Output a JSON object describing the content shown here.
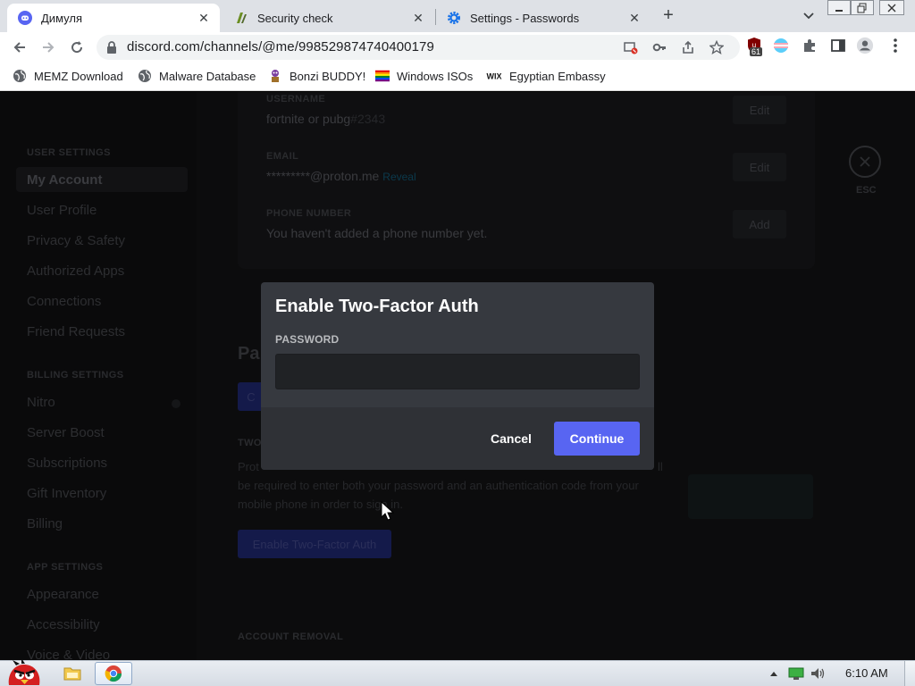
{
  "tabs": [
    {
      "label": "Димуля",
      "close": "✕",
      "favicon": "discord-icon"
    },
    {
      "label": "Security check",
      "close": "✕",
      "favicon": "security-check-icon"
    },
    {
      "label": "Settings - Passwords",
      "close": "✕",
      "favicon": "settings-gear-icon"
    }
  ],
  "tabstrip": {
    "new_tab": "+"
  },
  "address": {
    "url": "discord.com/channels/@me/998529874740400179",
    "extension_badge": "61"
  },
  "bookmarks": [
    {
      "label": "MEMZ Download",
      "icon": "globe-icon"
    },
    {
      "label": "Malware Database",
      "icon": "globe-icon"
    },
    {
      "label": "Bonzi BUDDY!",
      "icon": "bonzi-icon"
    },
    {
      "label": "Windows ISOs",
      "icon": "rainbow-flag-icon"
    },
    {
      "label": "Egyptian Embassy",
      "icon": "wix-icon"
    }
  ],
  "sidebar": {
    "user_settings_heading": "USER SETTINGS",
    "user_items": [
      "My Account",
      "User Profile",
      "Privacy & Safety",
      "Authorized Apps",
      "Connections",
      "Friend Requests"
    ],
    "billing_heading": "BILLING SETTINGS",
    "billing_items": [
      "Nitro",
      "Server Boost",
      "Subscriptions",
      "Gift Inventory",
      "Billing"
    ],
    "app_heading": "APP SETTINGS",
    "app_items": [
      "Appearance",
      "Accessibility",
      "Voice & Video"
    ]
  },
  "account_card": {
    "username_label": "USERNAME",
    "username_value": "fortnite or pubg",
    "username_tag": "#2343",
    "email_label": "EMAIL",
    "email_value": "*********@proton.me",
    "email_reveal": "Reveal",
    "phone_label": "PHONE NUMBER",
    "phone_value": "You haven't added a phone number yet.",
    "edit_label": "Edit",
    "edit_label_2": "Edit",
    "add_label": "Add"
  },
  "esc": {
    "label": "ESC"
  },
  "background_sections": {
    "password_title": "Pa",
    "change_btn": "C",
    "two_fa_heading": "TWO",
    "two_fa_desc_1": "Prot",
    "two_fa_desc_1_end": "ll",
    "two_fa_desc_2": "be required to enter both your password and an authentication code from your",
    "two_fa_desc_3": "mobile phone in order to sign in.",
    "enable_2fa_btn": "Enable Two-Factor Auth",
    "account_removal": "ACCOUNT REMOVAL"
  },
  "modal": {
    "title": "Enable Two-Factor Auth",
    "password_label": "PASSWORD",
    "password_value": "",
    "cancel": "Cancel",
    "continue": "Continue",
    "accent": "#5865f2"
  },
  "taskbar": {
    "clock": "6:10 AM"
  }
}
